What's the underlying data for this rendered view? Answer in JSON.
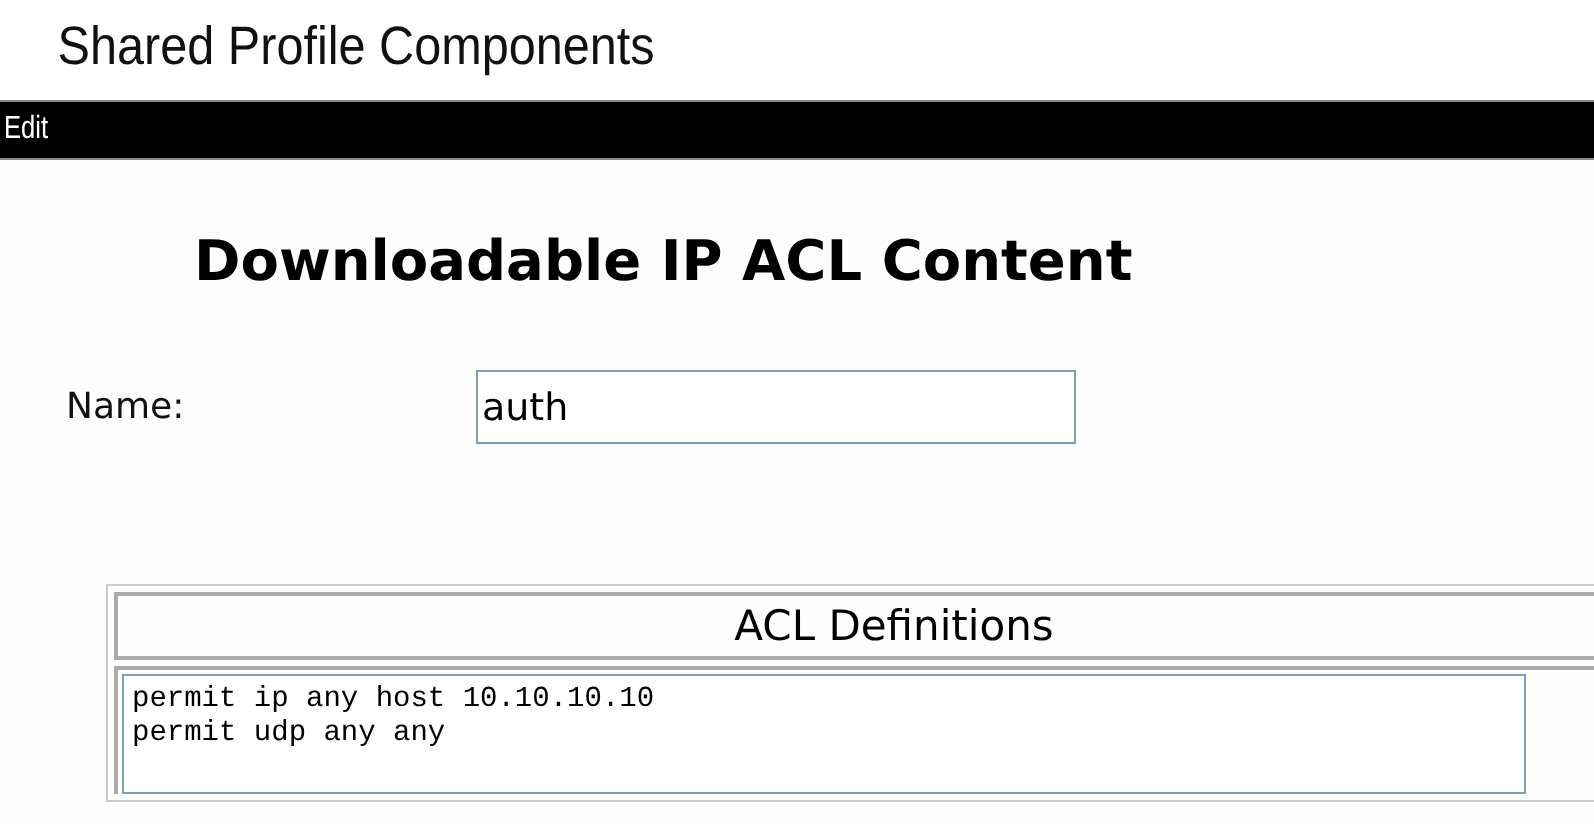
{
  "app_title": "Shared Profile Components",
  "menu_bar": {
    "items": [
      "Edit"
    ]
  },
  "heading": "Downloadable IP ACL Content",
  "name_field": {
    "label": "Name:",
    "value": "auth"
  },
  "acl_table": {
    "header": "ACL Definitions",
    "lines": [
      "permit ip any host 10.10.10.10",
      "permit udp any any"
    ]
  }
}
